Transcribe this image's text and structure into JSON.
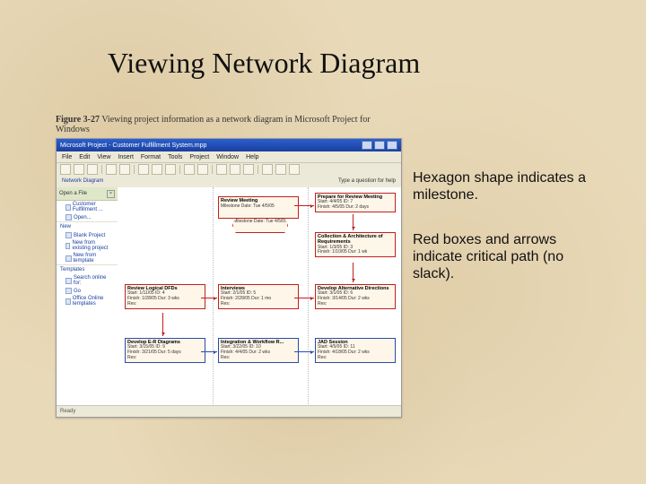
{
  "slide_title": "Viewing Network Diagram",
  "figure": {
    "label": "Figure 3-27",
    "caption": "Viewing project information as a network diagram in Microsoft Project for Windows"
  },
  "window": {
    "title": "Microsoft Project - Customer Fulfillment System.mpp",
    "menus": [
      "File",
      "Edit",
      "View",
      "Insert",
      "Format",
      "Tools",
      "Project",
      "Window",
      "Help"
    ],
    "help_prompt": "Type a question for help",
    "status": "Ready"
  },
  "pane": {
    "head": "Open a File",
    "items1": [
      "Customer Fulfillment ...",
      "Open..."
    ],
    "section_new": "New",
    "items2": [
      "Blank Project",
      "New from existing project",
      "New from template"
    ],
    "section_tpl": "Templates",
    "items3": [
      "Search online for:",
      "Go",
      "Office Online templates"
    ]
  },
  "nodes": {
    "review_meeting": {
      "title": "Review Meeting",
      "line": "Milestone Date: Tue 4/5/05"
    },
    "prep_review": {
      "title": "Prepare for Review Meeting",
      "line1": "Start: 4/4/05    ID: 7",
      "line2": "Finish: 4/5/05    Dur: 2 days"
    },
    "analysis": {
      "title": "Collection & Architecture of Requirements",
      "line1": "Start: 1/3/05    ID: 3",
      "line2": "Finish: 1/10/05    Dur: 1 wk"
    },
    "review_logic": {
      "title": "Review Logical DFDs",
      "line1": "Start: 1/11/05    ID: 4",
      "line2": "Finish: 1/28/05    Dur: 3 wks",
      "res": "Res:"
    },
    "interviews": {
      "title": "Interviews",
      "line1": "Start: 2/1/05    ID: 5",
      "line2": "Finish: 2/28/05    Dur: 1 mo",
      "res": "Res:"
    },
    "develop_alt": {
      "title": "Develop Alternative Directions",
      "line1": "Start: 3/1/05    ID: 6",
      "line2": "Finish: 3/14/05    Dur: 2 wks",
      "res": "Res:"
    },
    "er": {
      "title": "Develop E-R Diagrams",
      "line1": "Start: 3/15/05    ID: 9",
      "line2": "Finish: 3/21/05    Dur: 5 days",
      "res": "Res:"
    },
    "integration": {
      "title": "Integration & Workflow R...",
      "line1": "Start: 3/22/05    ID: 10",
      "line2": "Finish: 4/4/05    Dur: 2 wks",
      "res": "Res:"
    },
    "jad": {
      "title": "JAD Session",
      "line1": "Start: 4/5/05    ID: 11",
      "line2": "Finish: 4/18/05    Dur: 2 wks",
      "res": "Res:"
    }
  },
  "annotations": {
    "a1": "Hexagon shape indicates a milestone.",
    "a2": "Red boxes and arrows indicate critical path (no slack)."
  }
}
